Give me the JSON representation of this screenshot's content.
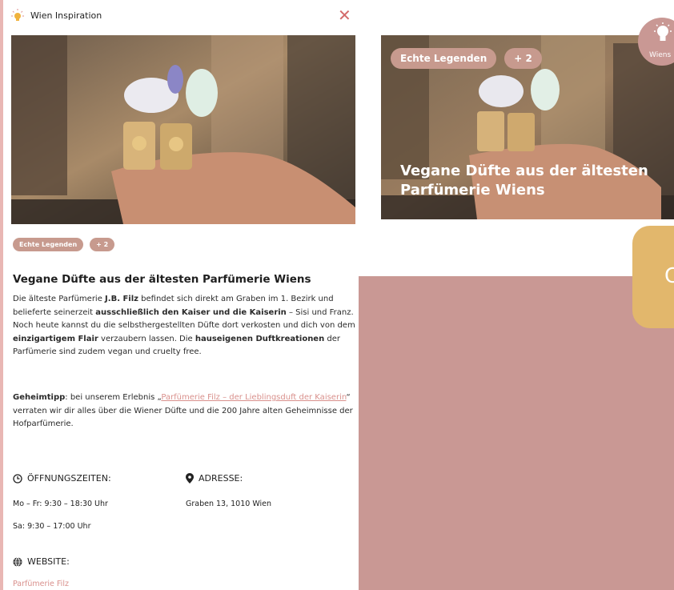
{
  "colors": {
    "accent": "#c99894",
    "gold": "#e2b76c",
    "chip": "#c79a8e",
    "link": "#d9908c",
    "close": "#d36a6a"
  },
  "modal": {
    "header_icon": "lightbulb-icon",
    "header_title": "Wien Inspiration",
    "close_icon": "close-icon",
    "tags": [
      "Echte Legenden",
      "+ 2"
    ],
    "title": "Vegane Düfte aus der ältesten Parfümerie Wiens",
    "desc": {
      "p1": "Die älteste Parfümerie ",
      "b1": "J.B. Filz",
      "p2": " befindet sich direkt am Graben im 1. Bezirk und belieferte seinerzeit ",
      "b2": "ausschließlich den Kaiser und die Kaiserin",
      "p3": " – Sisi und Franz. Noch heute kannst du die selbsthergestellten Düfte dort verkosten und dich von dem ",
      "b3": "einzigartigem Flair",
      "p4": " verzaubern lassen. Die ",
      "b4": "hauseigenen Duftkreationen",
      "p5": " der Parfümerie sind zudem vegan und cruelty free."
    },
    "tip": {
      "bold": "Geheimtipp",
      "p1": ": bei unserem Erlebnis „",
      "link": "Parfümerie Filz – der Lieblingsduft der Kaiserin",
      "p2": "“ verraten wir dir alles über die Wiener Düfte und die 200 Jahre alten Geheimnisse der Hofparfümerie."
    },
    "hours": {
      "icon": "clock-icon",
      "label": "ÖFFNUNGSZEITEN:",
      "line1": "Mo – Fr: 9:30 – 18:30 Uhr",
      "line2": "Sa: 9:30 – 17:00 Uhr"
    },
    "address": {
      "icon": "location-pin-icon",
      "label": "ADRESSE:",
      "line1": "Graben 13, 1010 Wien"
    },
    "website": {
      "icon": "globe-icon",
      "label": "WEBSITE:",
      "link": "Parfümerie Filz"
    }
  },
  "card": {
    "tags": [
      "Echte Legenden",
      "+ 2"
    ],
    "title": "Vegane Düfte aus der ältesten Parfümerie Wiens",
    "badge_icon": "lightbulb-icon",
    "badge_label": "Wiens"
  },
  "cta": {
    "letter": "C"
  }
}
